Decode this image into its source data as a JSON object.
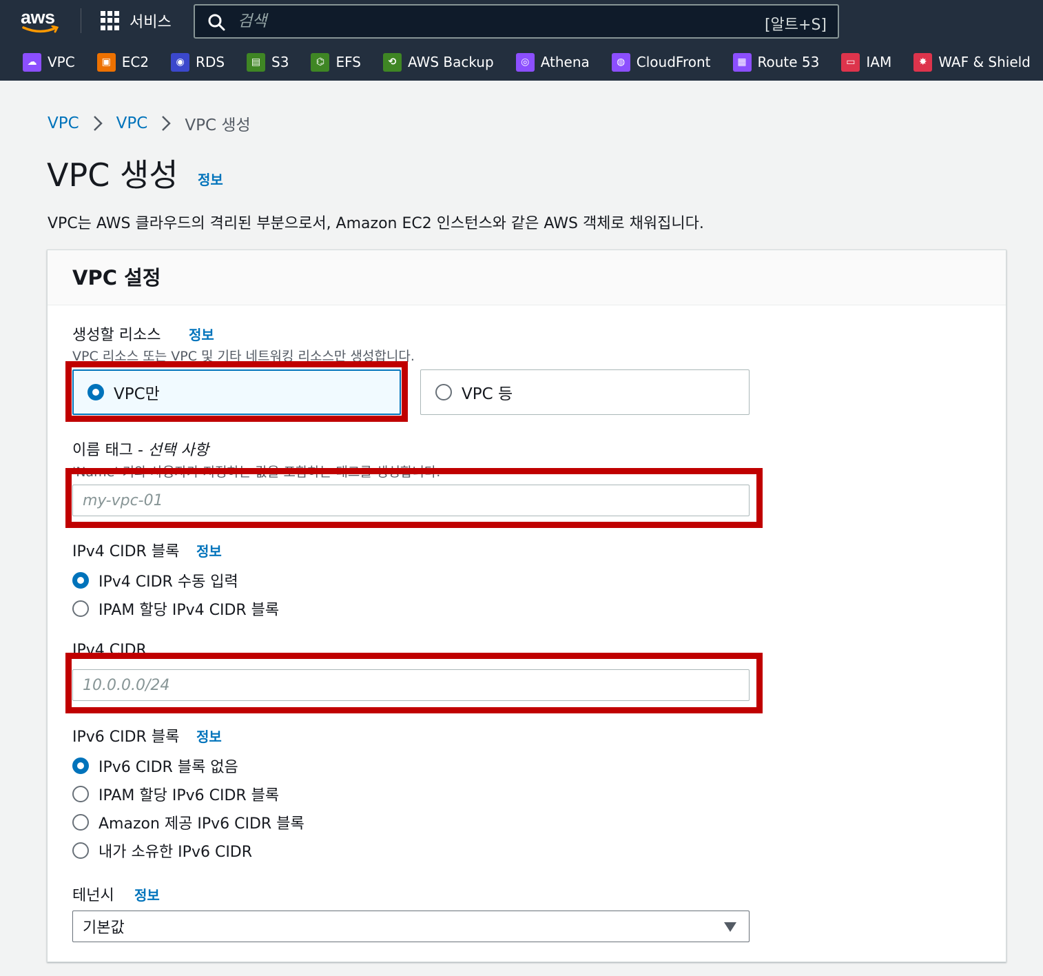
{
  "topbar": {
    "logo_text": "aws",
    "services_label": "서비스",
    "search_placeholder": "검색",
    "search_shortcut": "[알트+S]",
    "favorites": [
      {
        "label": "VPC",
        "icon": "vpc-icon",
        "color": "#8c4fff"
      },
      {
        "label": "EC2",
        "icon": "ec2-icon",
        "color": "#ed7100"
      },
      {
        "label": "RDS",
        "icon": "rds-icon",
        "color": "#3b48cc"
      },
      {
        "label": "S3",
        "icon": "s3-icon",
        "color": "#3f8624"
      },
      {
        "label": "EFS",
        "icon": "efs-icon",
        "color": "#3f8624"
      },
      {
        "label": "AWS Backup",
        "icon": "backup-icon",
        "color": "#3f8624"
      },
      {
        "label": "Athena",
        "icon": "athena-icon",
        "color": "#8c4fff"
      },
      {
        "label": "CloudFront",
        "icon": "cloudfront-icon",
        "color": "#8c4fff"
      },
      {
        "label": "Route 53",
        "icon": "route53-icon",
        "color": "#8c4fff"
      },
      {
        "label": "IAM",
        "icon": "iam-icon",
        "color": "#dd344c"
      },
      {
        "label": "WAF & Shield",
        "icon": "waf-icon",
        "color": "#dd344c"
      },
      {
        "label": "",
        "icon": "more-service-icon",
        "color": "#e7157b"
      }
    ]
  },
  "breadcrumb": {
    "items": [
      "VPC",
      "VPC"
    ],
    "current": "VPC 생성"
  },
  "page": {
    "title": "VPC 생성",
    "info": "정보",
    "description": "VPC는 AWS 클라우드의 격리된 부분으로서, Amazon EC2 인스턴스와 같은 AWS 객체로 채워집니다."
  },
  "settings": {
    "title": "VPC 설정",
    "resources": {
      "label": "생성할 리소스",
      "info": "정보",
      "description": "VPC 리소스 또는 VPC 및 기타 네트워킹 리소스만 생성합니다.",
      "options": [
        "VPC만",
        "VPC 등"
      ],
      "selected": 0
    },
    "name_tag": {
      "label": "이름 태그 - ",
      "label_optional": "선택 사항",
      "description": "'Name' 키와 사용자가 지정하는 값을 포함하는 태그를 생성합니다.",
      "placeholder": "my-vpc-01"
    },
    "ipv4_block": {
      "label": "IPv4 CIDR 블록",
      "info": "정보",
      "options": [
        "IPv4 CIDR 수동 입력",
        "IPAM 할당 IPv4 CIDR 블록"
      ],
      "selected": 0
    },
    "ipv4_cidr": {
      "label": "IPv4 CIDR",
      "placeholder": "10.0.0.0/24"
    },
    "ipv6_block": {
      "label": "IPv6 CIDR 블록",
      "info": "정보",
      "options": [
        "IPv6 CIDR 블록 없음",
        "IPAM 할당 IPv6 CIDR 블록",
        "Amazon 제공 IPv6 CIDR 블록",
        "내가 소유한 IPv6 CIDR"
      ],
      "selected": 0
    },
    "tenancy": {
      "label": "테넌시",
      "info": "정보",
      "value": "기본값"
    }
  },
  "colors": {
    "nav_bg": "#232f3e",
    "link": "#0073bb",
    "highlight": "#c00000"
  }
}
